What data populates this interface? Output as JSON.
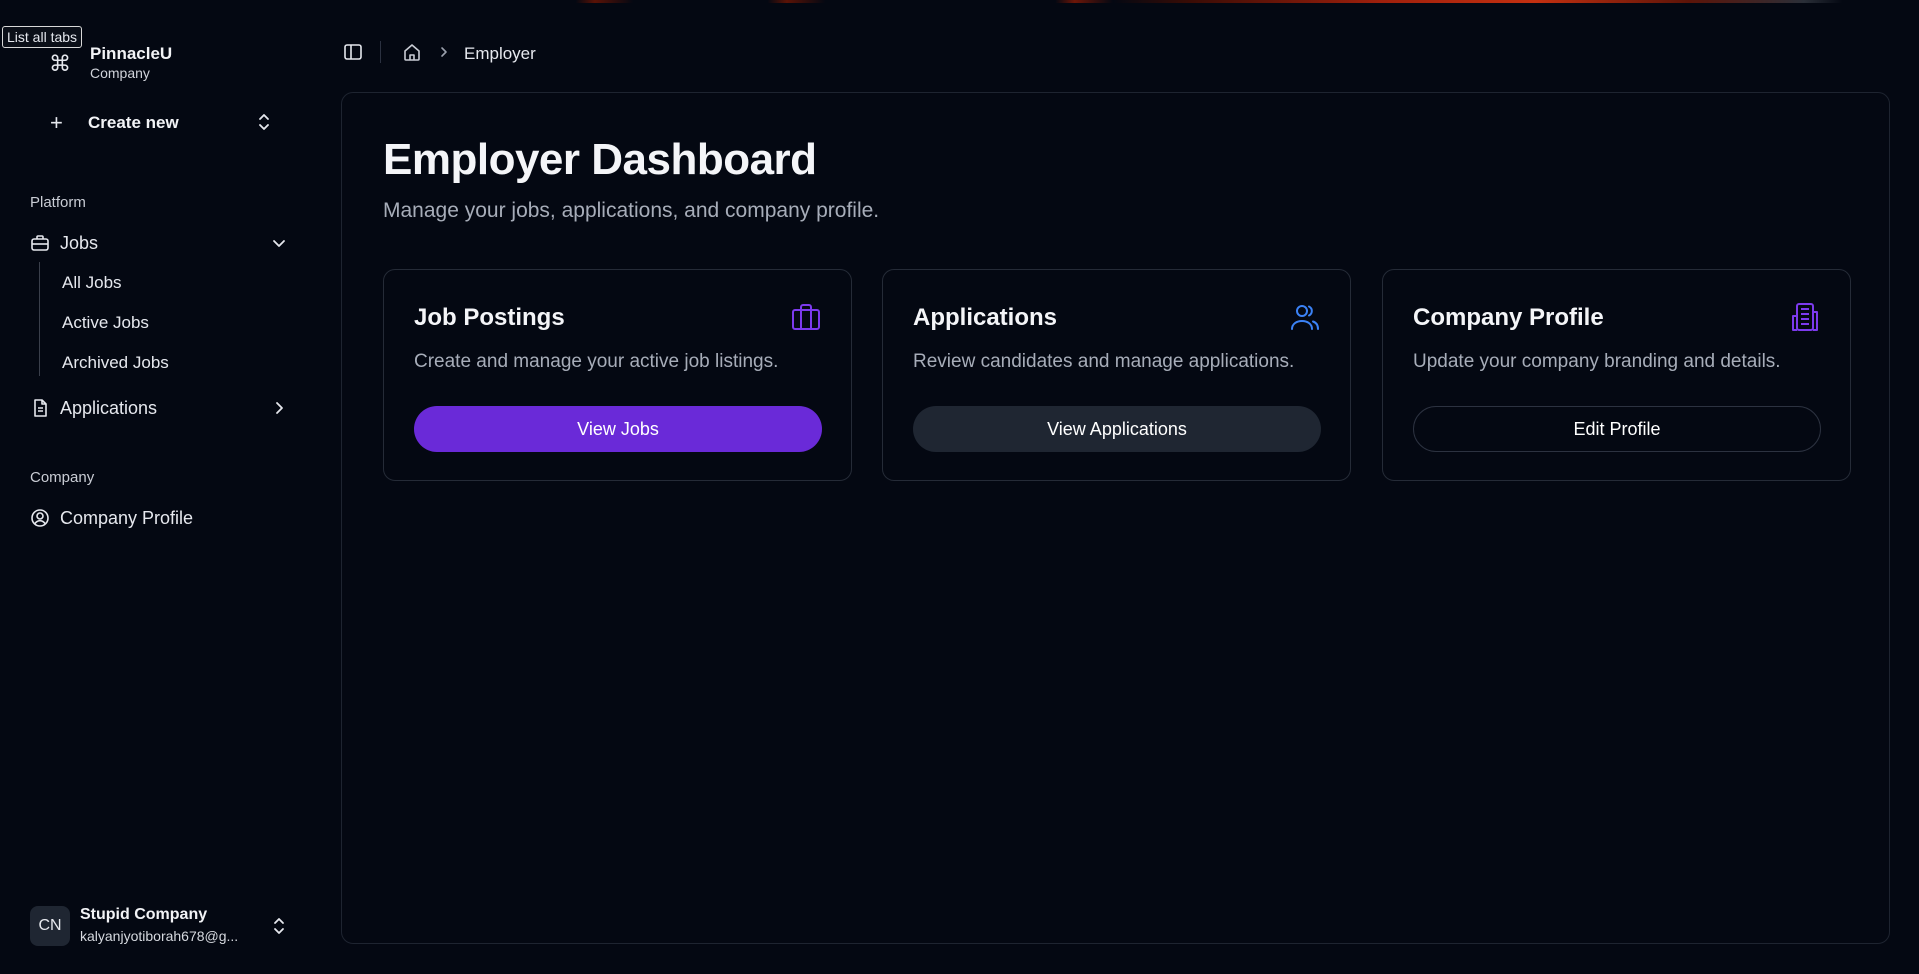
{
  "tooltip": "List all tabs",
  "brand": {
    "name": "PinnacleU",
    "subtitle": "Company",
    "icon": "command-icon"
  },
  "create_new": {
    "label": "Create new"
  },
  "sidebar": {
    "platform_label": "Platform",
    "jobs_label": "Jobs",
    "jobs_children": [
      "All Jobs",
      "Active Jobs",
      "Archived Jobs"
    ],
    "applications_label": "Applications",
    "company_label": "Company",
    "company_profile_label": "Company Profile"
  },
  "user": {
    "initials": "CN",
    "name": "Stupid Company",
    "email": "kalyanjyotiborah678@g..."
  },
  "breadcrumb": {
    "current": "Employer"
  },
  "main": {
    "title": "Employer Dashboard",
    "subtitle": "Manage your jobs, applications, and company profile.",
    "cards": [
      {
        "title": "Job Postings",
        "description": "Create and manage your active job listings.",
        "button": "View Jobs",
        "icon": "briefcase-icon"
      },
      {
        "title": "Applications",
        "description": "Review candidates and manage applications.",
        "button": "View Applications",
        "icon": "users-icon"
      },
      {
        "title": "Company Profile",
        "description": "Update your company branding and details.",
        "button": "Edit Profile",
        "icon": "building-icon"
      }
    ]
  },
  "colors": {
    "background": "#040812",
    "accent_purple": "#6a2ad8",
    "icon_purple": "#7c3aed",
    "icon_blue": "#3b82f6",
    "secondary_button": "#1f2632"
  }
}
